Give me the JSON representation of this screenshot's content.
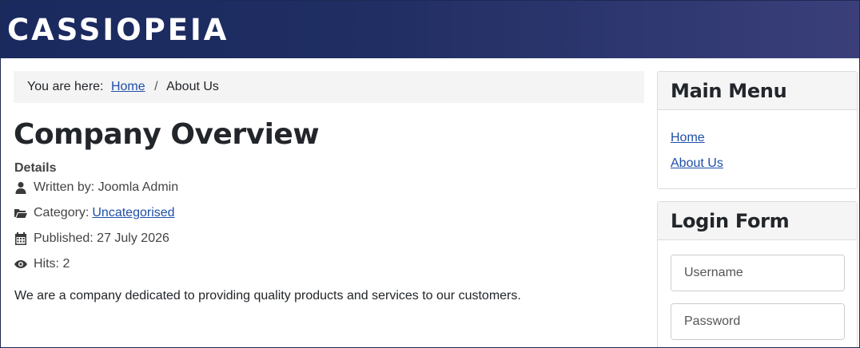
{
  "site": {
    "brand": "CASSIOPEIA"
  },
  "breadcrumb": {
    "prefix": "You are here:",
    "home": "Home",
    "separator": "/",
    "current": "About Us"
  },
  "article": {
    "title": "Company Overview",
    "details_label": "Details",
    "written_by": "Written by: Joomla Admin",
    "category_label": "Category:",
    "category_link": "Uncategorised",
    "published": "Published: 27 July 2026",
    "hits": "Hits: 2",
    "body": "We are a company dedicated to providing quality products and services to our customers."
  },
  "main_menu": {
    "title": "Main Menu",
    "items": [
      {
        "label": "Home"
      },
      {
        "label": "About Us"
      }
    ]
  },
  "login_form": {
    "title": "Login Form",
    "username_placeholder": "Username",
    "password_placeholder": "Password"
  },
  "colors": {
    "header_start": "#1a2a5e",
    "header_end": "#3a3f7a",
    "link": "#1f4fa8"
  }
}
